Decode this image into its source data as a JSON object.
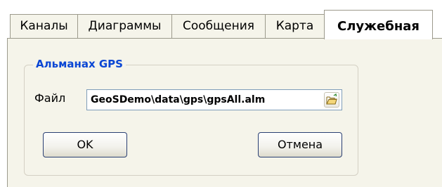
{
  "tabs": [
    {
      "label": "Каналы"
    },
    {
      "label": "Диаграммы"
    },
    {
      "label": "Сообщения"
    },
    {
      "label": "Карта"
    },
    {
      "label": "Служебная",
      "active": true
    }
  ],
  "almanac": {
    "group_title": "Альманах GPS",
    "file_label": "Файл",
    "file_value": "GeoSDemo\\data\\gps\\gpsAll.alm",
    "browse_icon": "folder-open-icon"
  },
  "buttons": {
    "ok": "OK",
    "cancel": "Отмена"
  },
  "colors": {
    "group_title": "#0a46d4",
    "panel_bg": "#f5f4ea",
    "border": "#9c9a8c",
    "button_border": "#2a3f73",
    "input_border": "#7f9db9"
  }
}
